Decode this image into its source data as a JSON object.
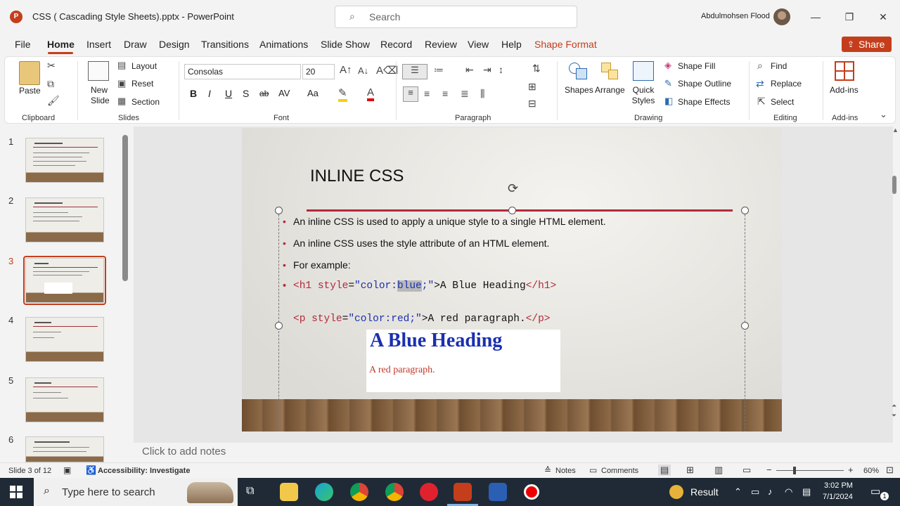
{
  "window": {
    "app_badge": "P",
    "title": "CSS ( Cascading Style Sheets).pptx  -  PowerPoint",
    "search_placeholder": "Search",
    "user": "Abdulmohsen Flood",
    "minimize": "—",
    "maximize": "❐",
    "close": "✕"
  },
  "tabs": [
    "File",
    "Home",
    "Insert",
    "Draw",
    "Design",
    "Transitions",
    "Animations",
    "Slide Show",
    "Record",
    "Review",
    "View",
    "Help",
    "Shape Format"
  ],
  "active_tab": "Home",
  "share_label": "Share",
  "ribbon": {
    "clipboard": {
      "paste": "Paste",
      "label": "Clipboard"
    },
    "slides": {
      "new_slide": "New Slide",
      "layout": "Layout",
      "reset": "Reset",
      "section": "Section",
      "label": "Slides"
    },
    "font": {
      "name": "Consolas",
      "size": "20",
      "label": "Font",
      "bold": "B",
      "italic": "I",
      "underline": "U",
      "shadow": "S",
      "strike": "ab",
      "spacing": "AV",
      "case": "Aa"
    },
    "paragraph": {
      "label": "Paragraph"
    },
    "drawing": {
      "shapes": "Shapes",
      "arrange": "Arrange",
      "quick_styles": "Quick Styles",
      "shape_fill": "Shape Fill",
      "shape_outline": "Shape Outline",
      "shape_effects": "Shape Effects",
      "label": "Drawing"
    },
    "editing": {
      "find": "Find",
      "replace": "Replace",
      "select": "Select",
      "label": "Editing"
    },
    "addins": {
      "button": "Add-ins",
      "label": "Add-ins"
    }
  },
  "thumbnails": [
    {
      "num": "1"
    },
    {
      "num": "2"
    },
    {
      "num": "3"
    },
    {
      "num": "4"
    },
    {
      "num": "5"
    },
    {
      "num": "6"
    }
  ],
  "selected_slide": 3,
  "slide": {
    "title": "INLINE CSS",
    "bullets": [
      "An inline CSS is used to apply a unique style to a single HTML element.",
      "An inline CSS uses the style attribute of an HTML element.",
      "For example:"
    ],
    "code1": {
      "tag_open": "<h1 ",
      "attr": "style",
      "eq": "=",
      "q1": "\"color:",
      "sel": "blue",
      "q2": ";\"",
      "gt": ">",
      "text": "A Blue Heading",
      "close": "</h1>"
    },
    "code2": {
      "tag_open": "<p ",
      "attr": "style",
      "eq": "=",
      "q1": "\"color:red;\"",
      "gt": ">",
      "text": "A red paragraph.",
      "close": "</p>"
    },
    "example_heading": "A Blue Heading",
    "example_paragraph": "A red paragraph."
  },
  "notes_placeholder": "Click to add notes",
  "status": {
    "slide_of": "Slide 3 of 12",
    "accessibility": "Accessibility: Investigate",
    "notes": "Notes",
    "comments": "Comments",
    "zoom": "60%"
  },
  "taskbar": {
    "search_placeholder": "Type here to search",
    "result": "Result",
    "time": "3:02 PM",
    "date": "7/1/2024",
    "notification_count": "1"
  },
  "colors": {
    "accent": "#c43e1c",
    "rule": "#b12a3c",
    "blue_heading": "#1a2fb0",
    "red_paragraph": "#c0392b"
  }
}
